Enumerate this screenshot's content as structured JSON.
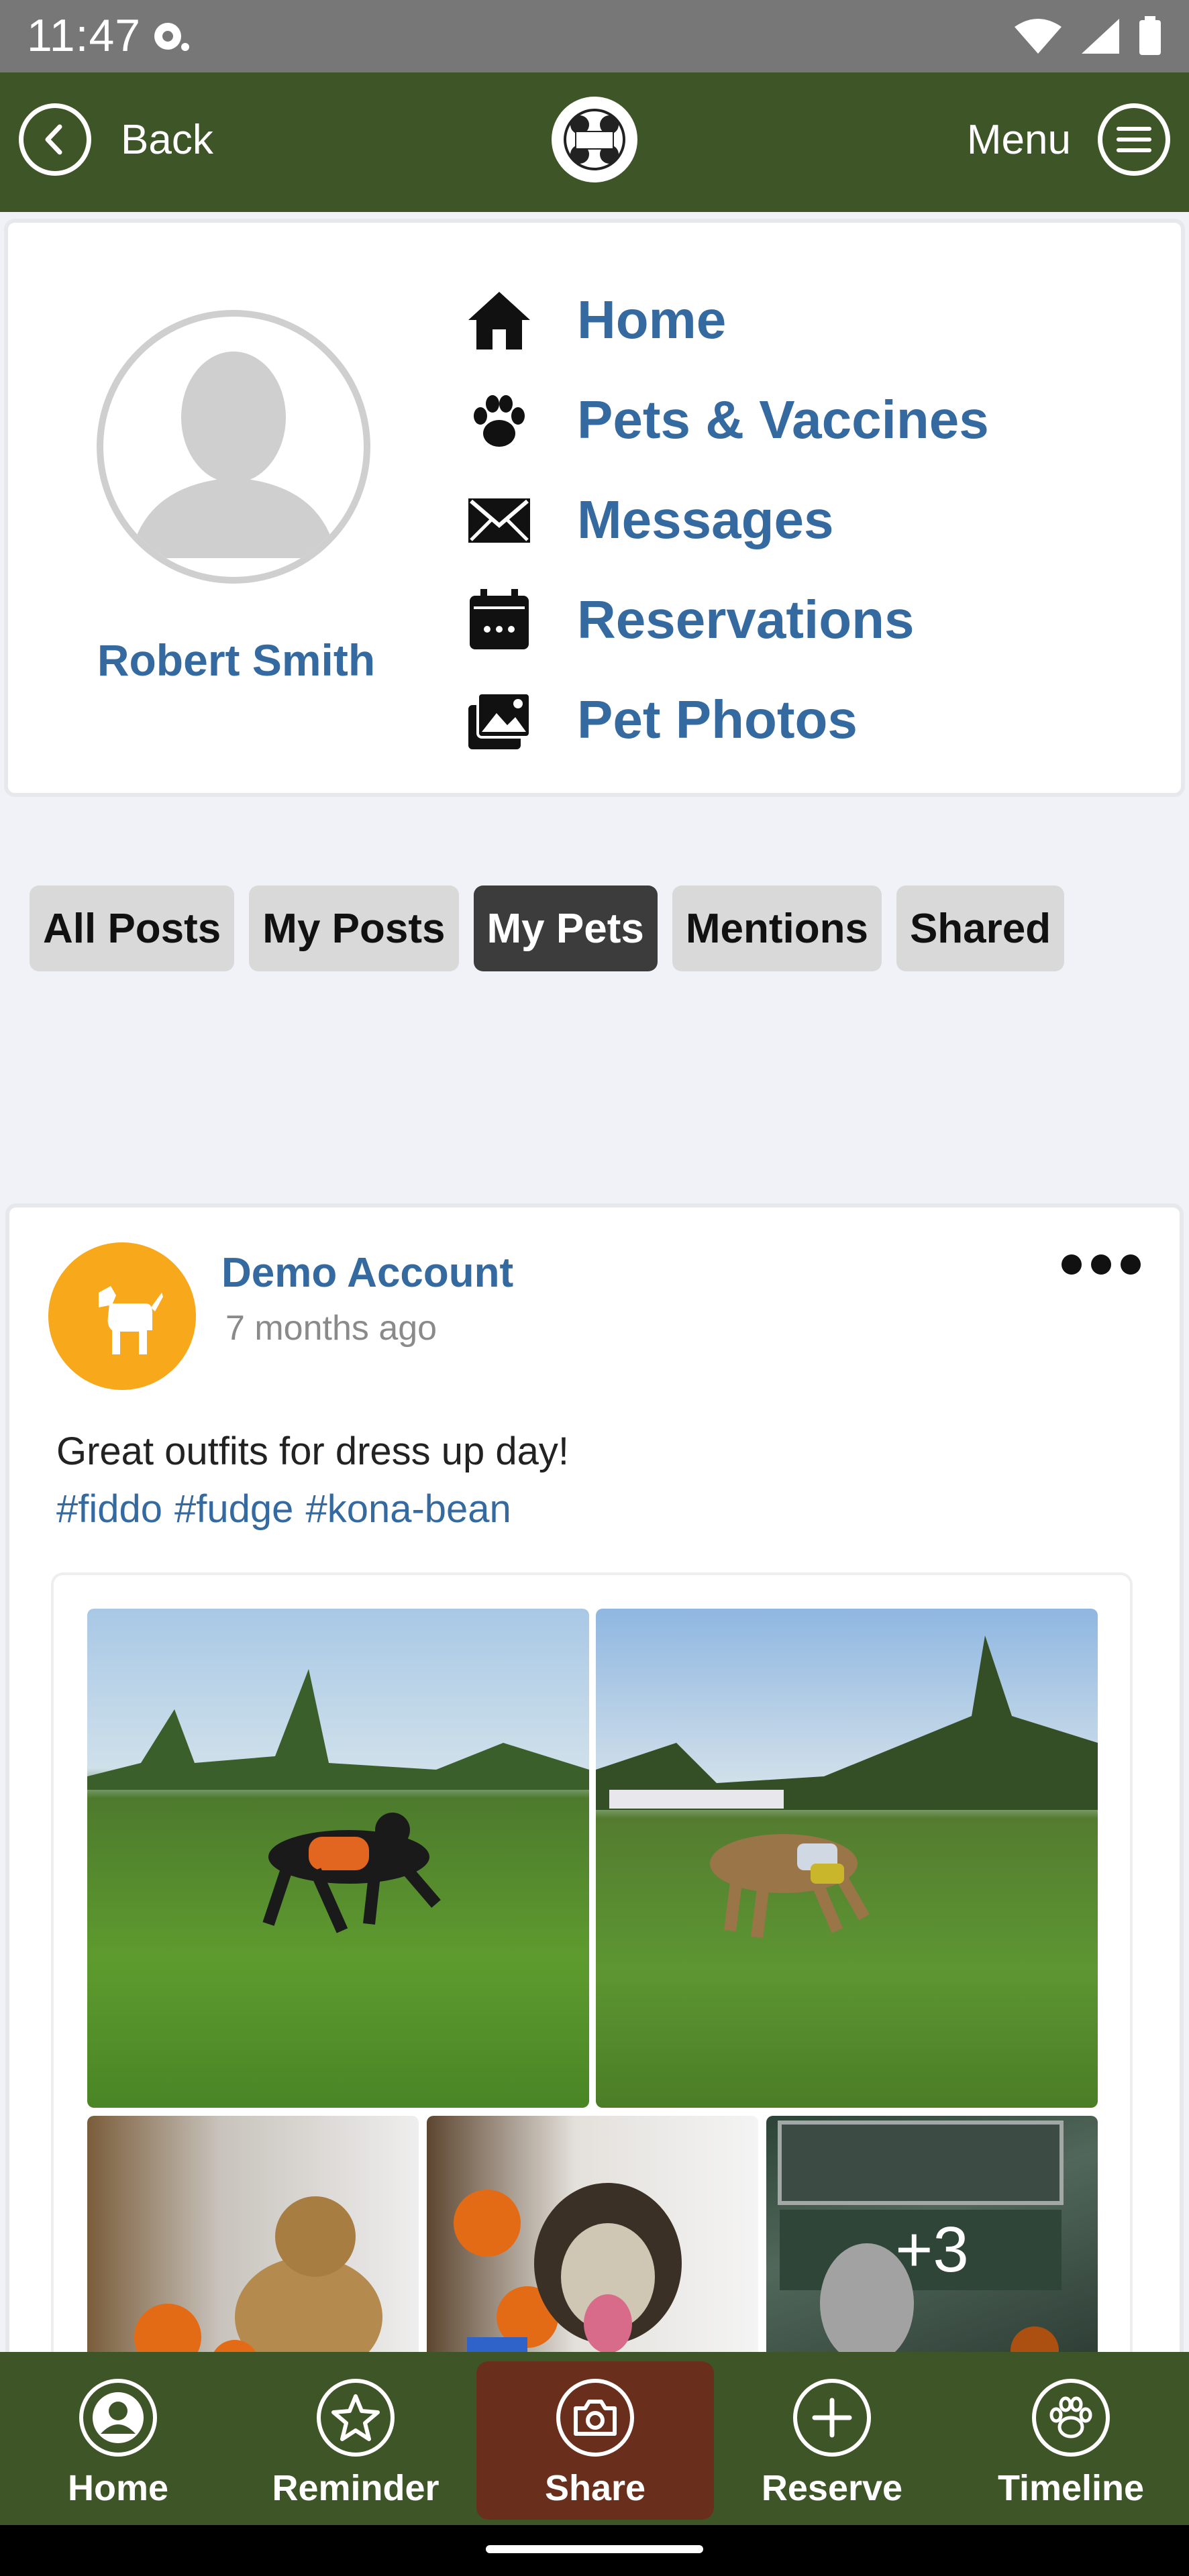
{
  "status_bar": {
    "time": "11:47"
  },
  "header": {
    "back_label": "Back",
    "menu_label": "Menu",
    "logo_name": "dog-ranch-logo"
  },
  "profile": {
    "name": "Robert Smith",
    "nav": [
      {
        "label": "Home",
        "icon": "home-icon"
      },
      {
        "label": "Pets & Vaccines",
        "icon": "paw-icon"
      },
      {
        "label": "Messages",
        "icon": "envelope-icon"
      },
      {
        "label": "Reservations",
        "icon": "calendar-icon"
      },
      {
        "label": "Pet Photos",
        "icon": "photos-icon"
      }
    ]
  },
  "tabs": [
    {
      "label": "All Posts",
      "active": false
    },
    {
      "label": "My Posts",
      "active": false
    },
    {
      "label": "My Pets",
      "active": true
    },
    {
      "label": "Mentions",
      "active": false
    },
    {
      "label": "Shared",
      "active": false
    }
  ],
  "post": {
    "author": "Demo Account",
    "time": "7 months ago",
    "text": "Great outfits for dress up day!",
    "tags": [
      "#fiddo",
      "#fudge",
      "#kona-bean"
    ],
    "more_photos": "+3"
  },
  "bottom_nav": [
    {
      "label": "Home",
      "icon": "user-icon"
    },
    {
      "label": "Reminder",
      "icon": "star-icon"
    },
    {
      "label": "Share",
      "icon": "camera-icon"
    },
    {
      "label": "Reserve",
      "icon": "plus-icon"
    },
    {
      "label": "Timeline",
      "icon": "paw-icon"
    }
  ],
  "colors": {
    "brand_green": "#3e5528",
    "link_blue": "#356aa0",
    "share_brown": "#6a2f1c",
    "avatar_orange": "#f7a81b"
  }
}
